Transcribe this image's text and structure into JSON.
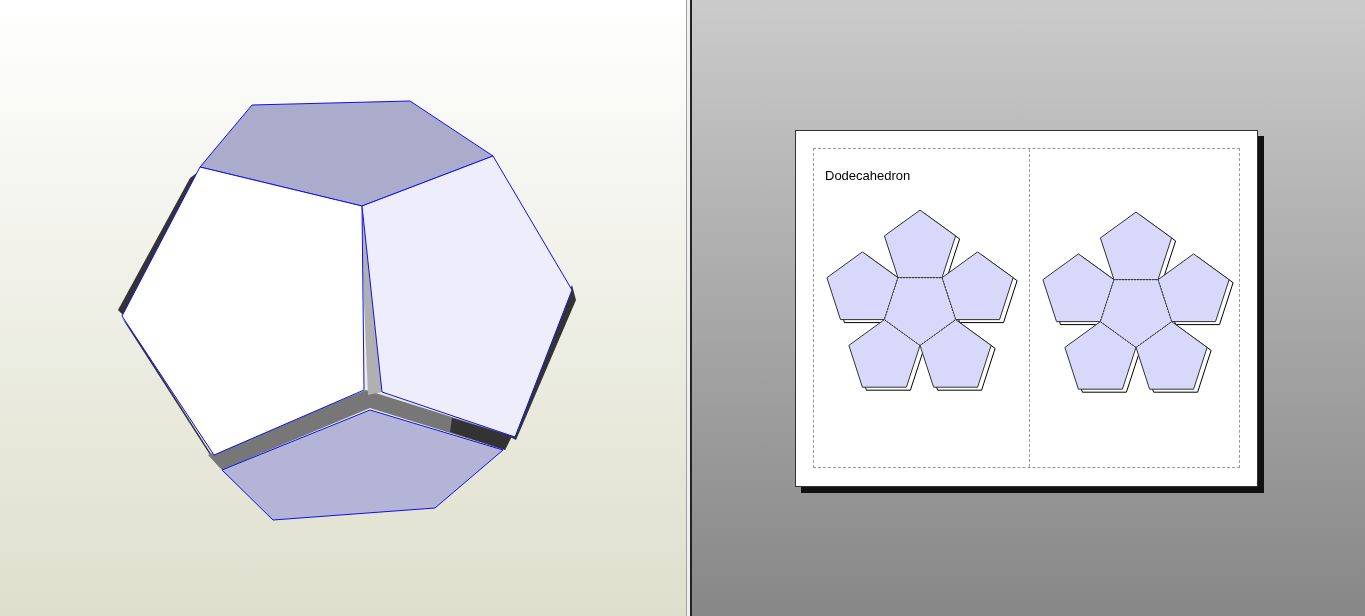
{
  "sheet": {
    "title": "Dodecahedron"
  }
}
